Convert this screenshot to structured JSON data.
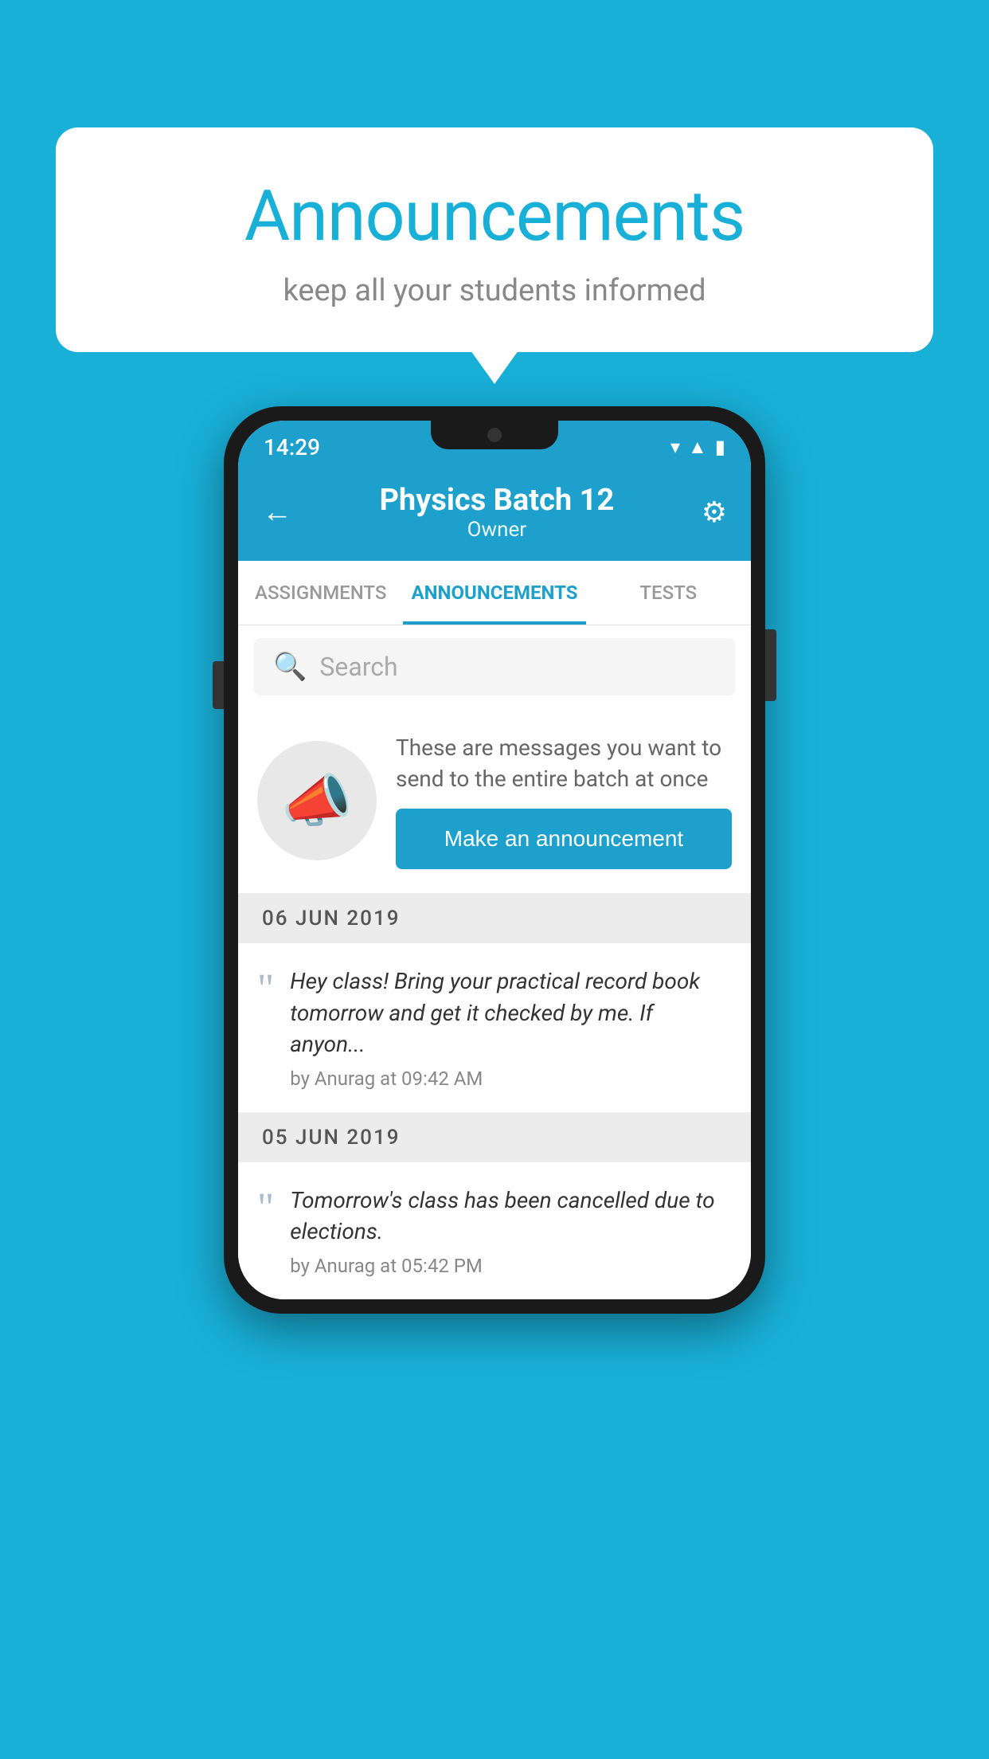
{
  "background_color": "#19b0d8",
  "speech_bubble": {
    "title": "Announcements",
    "subtitle": "keep all your students informed"
  },
  "phone": {
    "status_bar": {
      "time": "14:29",
      "wifi": "▾",
      "signal": "▲",
      "battery": "▮"
    },
    "header": {
      "title": "Physics Batch 12",
      "subtitle": "Owner",
      "back_label": "←",
      "settings_label": "⚙"
    },
    "tabs": [
      {
        "label": "ASSIGNMENTS",
        "active": false
      },
      {
        "label": "ANNOUNCEMENTS",
        "active": true
      },
      {
        "label": "TESTS",
        "active": false
      }
    ],
    "search": {
      "placeholder": "Search"
    },
    "intro": {
      "message": "These are messages you want to send to the entire batch at once",
      "button_label": "Make an announcement"
    },
    "announcements": [
      {
        "date": "06  JUN  2019",
        "text": "Hey class! Bring your practical record book tomorrow and get it checked by me. If anyon...",
        "meta": "by Anurag at 09:42 AM"
      },
      {
        "date": "05  JUN  2019",
        "text": "Tomorrow's class has been cancelled due to elections.",
        "meta": "by Anurag at 05:42 PM"
      }
    ]
  }
}
